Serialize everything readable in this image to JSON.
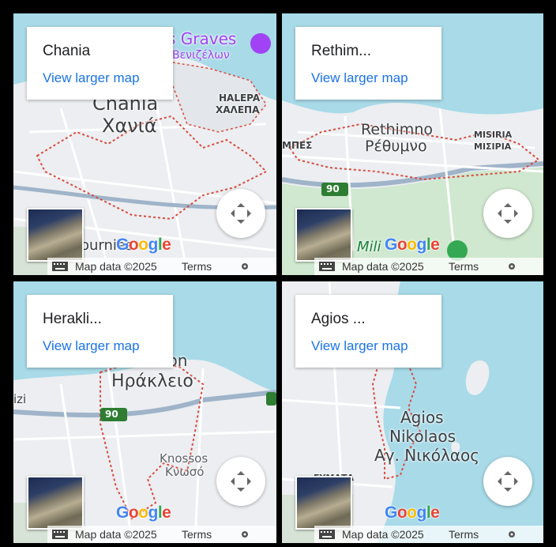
{
  "colors": {
    "water": "#a8dae8",
    "land": "#eceef1",
    "park": "#cfe8cf",
    "road": "#ffffff",
    "highway": "#9fb4c9",
    "boundary": "#d94b3f",
    "link": "#1a73e8",
    "shield": "#2e7d32"
  },
  "maps": [
    {
      "title": "Chania",
      "link": "View larger map",
      "labels": [
        "Chania",
        "Χανιά",
        "HALEPA",
        "ΧΑΛΕΠΑ",
        "s Graves",
        "Βενιζέλων",
        "ournies"
      ],
      "attribution": {
        "logo": "Google",
        "data": "Map data ©2025",
        "terms": "Terms"
      }
    },
    {
      "title": "Rethim...",
      "link": "View larger map",
      "labels": [
        "Rethimno",
        "Ρέθυμνο",
        "MISIRIA",
        "ΜΙΣΙΡΙΑ",
        "ΜΠΕΣ",
        "90",
        "Mili"
      ],
      "attribution": {
        "logo": "Google",
        "data": "Map data ©2025",
        "terms": "Terms"
      }
    },
    {
      "title": "Herakli...",
      "link": "View larger map",
      "labels": [
        "Heraklion",
        "Ηράκλειο",
        "Knossos",
        "Κνωσό",
        "90",
        "izi"
      ],
      "attribution": {
        "logo": "Google",
        "data": "Map data ©2025",
        "terms": "Terms"
      }
    },
    {
      "title": "Agios ...",
      "link": "View larger map",
      "labels": [
        "Agios",
        "Nikolaos",
        "Αγ. Νικόλαος",
        "ΣΥΜΑΤΑ"
      ],
      "attribution": {
        "logo": "Google",
        "data": "Map data ©2025",
        "terms": "Terms"
      }
    }
  ]
}
